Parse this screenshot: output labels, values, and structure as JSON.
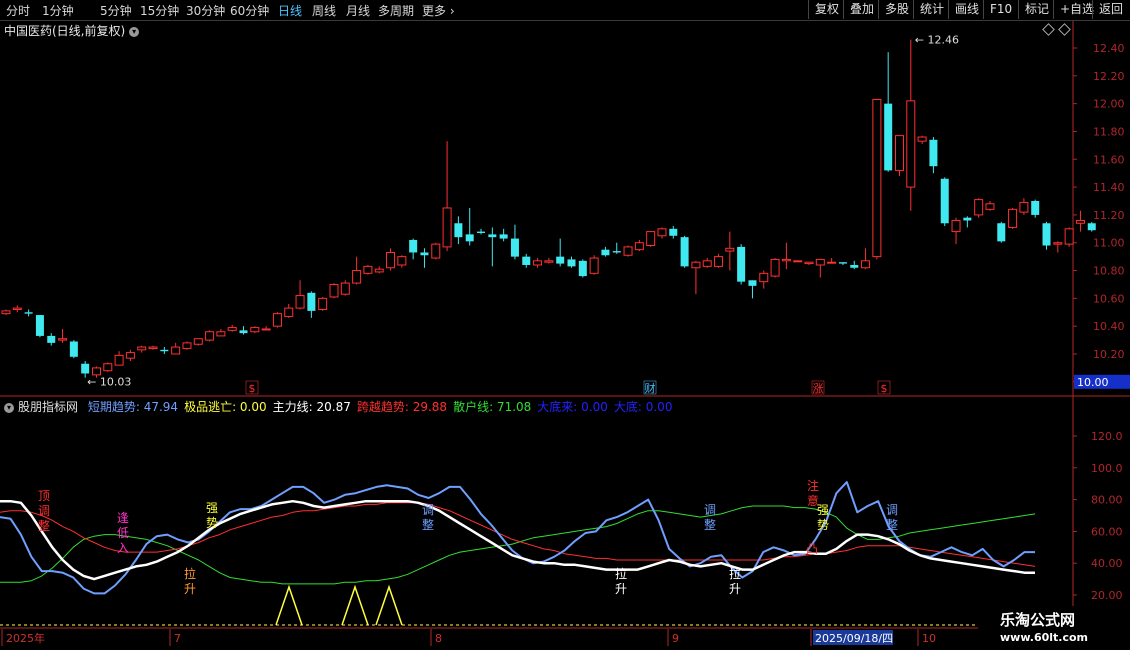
{
  "toolbar": {
    "timeframes": [
      "分时",
      "1分钟",
      "5分钟",
      "15分钟",
      "30分钟",
      "60分钟",
      "日线",
      "周线",
      "月线",
      "多周期",
      "更多"
    ],
    "active": "日线",
    "right_buttons": [
      "复权",
      "叠加",
      "多股",
      "统计",
      "画线",
      "F10",
      "标记",
      "+自选",
      "返回"
    ]
  },
  "main_chart": {
    "title": "中国医药(日线,前复权)",
    "y_ticks": [
      "12.40",
      "12.20",
      "12.00",
      "11.80",
      "11.60",
      "11.40",
      "11.20",
      "11.00",
      "10.80",
      "10.60",
      "10.40",
      "10.20",
      "10.00"
    ],
    "current_price": "10.00",
    "high_label": "12.46",
    "low_label": "10.03",
    "markers": [
      {
        "text": "$",
        "color": "#ff3030"
      },
      {
        "text": "财",
        "color": "#4ec3ff"
      },
      {
        "text": "涨",
        "color": "#ff3030"
      },
      {
        "text": "$",
        "color": "#ff3030"
      }
    ],
    "candles": [
      [
        10.49,
        10.51,
        10.48,
        10.52
      ],
      [
        10.52,
        10.53,
        10.5,
        10.55
      ],
      [
        10.5,
        10.49,
        10.47,
        10.52
      ],
      [
        10.48,
        10.33,
        10.32,
        10.48
      ],
      [
        10.33,
        10.28,
        10.26,
        10.35
      ],
      [
        10.3,
        10.31,
        10.28,
        10.38
      ],
      [
        10.29,
        10.18,
        10.17,
        10.3
      ],
      [
        10.13,
        10.06,
        10.03,
        10.15
      ],
      [
        10.05,
        10.1,
        10.03,
        10.11
      ],
      [
        10.08,
        10.13,
        10.07,
        10.14
      ],
      [
        10.12,
        10.19,
        10.12,
        10.22
      ],
      [
        10.17,
        10.21,
        10.15,
        10.23
      ],
      [
        10.23,
        10.25,
        10.21,
        10.26
      ],
      [
        10.24,
        10.25,
        10.23,
        10.26
      ],
      [
        10.23,
        10.22,
        10.2,
        10.25
      ],
      [
        10.2,
        10.25,
        10.2,
        10.28
      ],
      [
        10.24,
        10.28,
        10.23,
        10.29
      ],
      [
        10.27,
        10.31,
        10.26,
        10.31
      ],
      [
        10.3,
        10.36,
        10.29,
        10.37
      ],
      [
        10.33,
        10.36,
        10.33,
        10.38
      ],
      [
        10.37,
        10.39,
        10.36,
        10.41
      ],
      [
        10.37,
        10.35,
        10.34,
        10.4
      ],
      [
        10.36,
        10.39,
        10.35,
        10.4
      ],
      [
        10.38,
        10.38,
        10.37,
        10.4
      ],
      [
        10.4,
        10.49,
        10.39,
        10.5
      ],
      [
        10.47,
        10.53,
        10.46,
        10.56
      ],
      [
        10.53,
        10.62,
        10.52,
        10.73
      ],
      [
        10.64,
        10.51,
        10.46,
        10.65
      ],
      [
        10.52,
        10.6,
        10.51,
        10.61
      ],
      [
        10.61,
        10.7,
        10.6,
        10.71
      ],
      [
        10.63,
        10.71,
        10.62,
        10.73
      ],
      [
        10.71,
        10.8,
        10.7,
        10.9
      ],
      [
        10.78,
        10.83,
        10.77,
        10.84
      ],
      [
        10.79,
        10.81,
        10.78,
        10.83
      ],
      [
        10.82,
        10.93,
        10.8,
        10.96
      ],
      [
        10.84,
        10.9,
        10.82,
        10.91
      ],
      [
        11.02,
        10.93,
        10.88,
        11.03
      ],
      [
        10.93,
        10.91,
        10.82,
        10.96
      ],
      [
        10.89,
        10.99,
        10.88,
        11.0
      ],
      [
        10.97,
        11.25,
        10.94,
        11.73
      ],
      [
        11.14,
        11.04,
        10.99,
        11.19
      ],
      [
        11.06,
        11.01,
        10.98,
        11.25
      ],
      [
        11.08,
        11.07,
        11.06,
        11.1
      ],
      [
        11.06,
        11.04,
        10.83,
        11.11
      ],
      [
        11.06,
        11.03,
        11.01,
        11.1
      ],
      [
        11.03,
        10.9,
        10.88,
        11.13
      ],
      [
        10.9,
        10.84,
        10.82,
        10.92
      ],
      [
        10.84,
        10.87,
        10.82,
        10.89
      ],
      [
        10.86,
        10.87,
        10.85,
        10.89
      ],
      [
        10.9,
        10.85,
        10.83,
        11.03
      ],
      [
        10.88,
        10.83,
        10.82,
        10.9
      ],
      [
        10.87,
        10.76,
        10.75,
        10.88
      ],
      [
        10.78,
        10.89,
        10.77,
        10.91
      ],
      [
        10.95,
        10.91,
        10.9,
        10.97
      ],
      [
        10.94,
        10.93,
        10.92,
        11.0
      ],
      [
        10.91,
        10.97,
        10.9,
        10.98
      ],
      [
        10.95,
        11.0,
        10.94,
        11.02
      ],
      [
        10.98,
        11.08,
        10.97,
        11.08
      ],
      [
        11.05,
        11.1,
        11.03,
        11.11
      ],
      [
        11.1,
        11.05,
        11.03,
        11.12
      ],
      [
        11.04,
        10.83,
        10.82,
        11.05
      ],
      [
        10.82,
        10.86,
        10.63,
        10.87
      ],
      [
        10.83,
        10.87,
        10.82,
        10.89
      ],
      [
        10.83,
        10.9,
        10.82,
        10.92
      ],
      [
        10.94,
        10.96,
        10.8,
        11.08
      ],
      [
        10.97,
        10.72,
        10.7,
        10.99
      ],
      [
        10.73,
        10.69,
        10.6,
        10.73
      ],
      [
        10.72,
        10.78,
        10.67,
        10.8
      ],
      [
        10.76,
        10.88,
        10.75,
        10.89
      ],
      [
        10.87,
        10.88,
        10.81,
        11.0
      ],
      [
        10.87,
        10.87,
        10.87,
        10.87
      ],
      [
        10.85,
        10.86,
        10.84,
        10.86
      ],
      [
        10.84,
        10.88,
        10.75,
        10.88
      ],
      [
        10.86,
        10.86,
        10.86,
        10.89
      ],
      [
        10.86,
        10.85,
        10.84,
        10.86
      ],
      [
        10.84,
        10.82,
        10.81,
        10.87
      ],
      [
        10.82,
        10.87,
        10.81,
        10.96
      ],
      [
        10.9,
        12.03,
        10.88,
        12.03
      ],
      [
        12.0,
        11.52,
        11.51,
        12.37
      ],
      [
        11.52,
        11.77,
        11.48,
        11.77
      ],
      [
        11.4,
        12.02,
        11.23,
        12.46
      ],
      [
        11.73,
        11.76,
        11.71,
        11.77
      ],
      [
        11.74,
        11.55,
        11.5,
        11.76
      ],
      [
        11.46,
        11.14,
        11.12,
        11.47
      ],
      [
        11.08,
        11.16,
        10.99,
        11.18
      ],
      [
        11.18,
        11.16,
        11.11,
        11.19
      ],
      [
        11.2,
        11.31,
        11.18,
        11.32
      ],
      [
        11.24,
        11.28,
        11.23,
        11.3
      ],
      [
        11.14,
        11.01,
        11.0,
        11.15
      ],
      [
        11.11,
        11.24,
        11.1,
        11.25
      ],
      [
        11.22,
        11.29,
        11.2,
        11.32
      ],
      [
        11.3,
        11.2,
        11.18,
        11.31
      ],
      [
        11.14,
        10.98,
        10.95,
        11.15
      ],
      [
        10.99,
        11.0,
        10.93,
        11.01
      ],
      [
        10.99,
        11.1,
        10.97,
        11.11
      ],
      [
        11.14,
        11.16,
        11.08,
        11.23
      ],
      [
        11.14,
        11.09,
        11.08,
        11.15
      ]
    ]
  },
  "indicator": {
    "name": "股朋指标网",
    "items": [
      {
        "label": "短期趋势:",
        "value": "47.94",
        "color": "#6f9fff"
      },
      {
        "label": "极品逃亡:",
        "value": "0.00",
        "color": "#ffff40"
      },
      {
        "label": "主力线:",
        "value": "20.87",
        "color": "#ffffff"
      },
      {
        "label": "跨越趋势:",
        "value": "29.88",
        "color": "#ff3030"
      },
      {
        "label": "散户线:",
        "value": "71.08",
        "color": "#33dd33"
      },
      {
        "label": "大底来:",
        "value": "0.00",
        "color": "#2222ff"
      },
      {
        "label": "大底:",
        "value": "0.00",
        "color": "#2222ff"
      }
    ],
    "y_ticks": [
      "120.0",
      "100.0",
      "80.00",
      "60.00",
      "40.00",
      "20.00"
    ],
    "series": {
      "blue": [
        69,
        68,
        58,
        44,
        35,
        35,
        34,
        31,
        24,
        21,
        21,
        26,
        33,
        42,
        52,
        57,
        58,
        55,
        53,
        55,
        60,
        66,
        72,
        74,
        74,
        76,
        80,
        84,
        88,
        88,
        84,
        78,
        80,
        83,
        84,
        86,
        88,
        89,
        88,
        87,
        83,
        81,
        84,
        88,
        88,
        80,
        71,
        64,
        56,
        48,
        43,
        40,
        41,
        44,
        48,
        54,
        59,
        60,
        67,
        69,
        72,
        76,
        80,
        67,
        49,
        43,
        38,
        40,
        44,
        45,
        37,
        31,
        35,
        47,
        50,
        48,
        45,
        46,
        55,
        66,
        84,
        91,
        72,
        76,
        79,
        63,
        54,
        49,
        45,
        44,
        47,
        50,
        47,
        45,
        49,
        42,
        38,
        42,
        47,
        47
      ],
      "white": [
        79,
        79,
        78,
        70,
        60,
        50,
        42,
        36,
        32,
        30,
        32,
        34,
        36,
        38,
        39,
        41,
        44,
        47,
        51,
        56,
        61,
        65,
        68,
        71,
        73,
        75,
        77,
        78,
        79,
        78,
        76,
        75,
        76,
        77,
        78,
        79,
        79,
        79,
        79,
        79,
        78,
        76,
        73,
        69,
        65,
        61,
        57,
        53,
        49,
        45,
        43,
        41,
        40,
        40,
        39,
        39,
        38,
        37,
        36,
        36,
        36,
        36,
        38,
        40,
        42,
        41,
        39,
        38,
        39,
        40,
        38,
        36,
        36,
        39,
        42,
        45,
        47,
        47,
        46,
        46,
        49,
        54,
        58,
        58,
        57,
        55,
        52,
        48,
        45,
        43,
        42,
        41,
        40,
        39,
        38,
        37,
        36,
        35,
        34,
        34
      ],
      "red": [
        72,
        73,
        73,
        72,
        70,
        67,
        63,
        60,
        56,
        53,
        50,
        48,
        47,
        47,
        47,
        47,
        48,
        49,
        51,
        53,
        56,
        58,
        61,
        63,
        65,
        67,
        69,
        70,
        72,
        73,
        73,
        74,
        75,
        76,
        76,
        77,
        77,
        78,
        78,
        78,
        78,
        77,
        75,
        73,
        70,
        67,
        64,
        61,
        58,
        55,
        53,
        51,
        49,
        48,
        46,
        45,
        44,
        43,
        43,
        42,
        42,
        42,
        42,
        42,
        42,
        42,
        42,
        42,
        42,
        42,
        42,
        42,
        42,
        42,
        43,
        44,
        44,
        45,
        46,
        46,
        47,
        48,
        50,
        51,
        51,
        51,
        51,
        50,
        49,
        48,
        47,
        46,
        45,
        44,
        43,
        42,
        41,
        40,
        39,
        38
      ],
      "green": [
        28,
        28,
        28,
        29,
        32,
        37,
        43,
        50,
        55,
        57,
        58,
        58,
        57,
        56,
        55,
        53,
        51,
        48,
        45,
        42,
        38,
        34,
        31,
        30,
        29,
        28,
        28,
        27,
        27,
        27,
        27,
        27,
        27,
        28,
        28,
        29,
        29,
        30,
        31,
        33,
        36,
        39,
        42,
        45,
        47,
        48,
        49,
        50,
        51,
        52,
        54,
        56,
        57,
        58,
        59,
        60,
        61,
        62,
        63,
        65,
        68,
        71,
        73,
        73,
        72,
        71,
        70,
        69,
        70,
        71,
        73,
        75,
        76,
        76,
        76,
        76,
        75,
        75,
        74,
        72,
        69,
        62,
        58,
        55,
        55,
        56,
        57,
        59,
        60,
        61,
        62,
        63,
        64,
        65,
        66,
        67,
        68,
        69,
        70,
        71
      ],
      "yellow_spikes": [
        29,
        36,
        38
      ]
    },
    "annotations": [
      {
        "lines": [
          "顶",
          "调",
          "整"
        ],
        "color": "#ff3030"
      },
      {
        "lines": [
          "逢",
          "低",
          "入"
        ],
        "color": "#ff33cc"
      },
      {
        "lines": [
          "强",
          "势"
        ],
        "color": "#ffff40"
      },
      {
        "lines": [
          "拉",
          "升"
        ],
        "color": "#ff9933"
      },
      {
        "lines": [
          "调",
          "整"
        ],
        "color": "#6f9fff"
      },
      {
        "lines": [
          "拉",
          "升"
        ],
        "color": "#ffffff"
      },
      {
        "lines": [
          "调",
          "整"
        ],
        "color": "#6f9fff"
      },
      {
        "lines": [
          "拉",
          "升"
        ],
        "color": "#ffffff"
      },
      {
        "lines": [
          "注",
          "意"
        ],
        "color": "#ff3030"
      },
      {
        "lines": [
          "强",
          "势"
        ],
        "color": "#ffff40"
      },
      {
        "lines": [
          "凸"
        ],
        "color": "#ff3030"
      },
      {
        "lines": [
          "调",
          "整"
        ],
        "color": "#6f9fff"
      }
    ]
  },
  "date_axis": {
    "labels": [
      "2025年",
      "7",
      "8",
      "9",
      "2025/09/18/四",
      "10"
    ]
  },
  "watermark": {
    "line1": "乐淘公式网",
    "line2": "www.60lt.com"
  },
  "colors": {
    "up": "#ff3030",
    "down": "#40e8f0",
    "axis": "#b0262a",
    "grid": "#7a1a1a"
  }
}
